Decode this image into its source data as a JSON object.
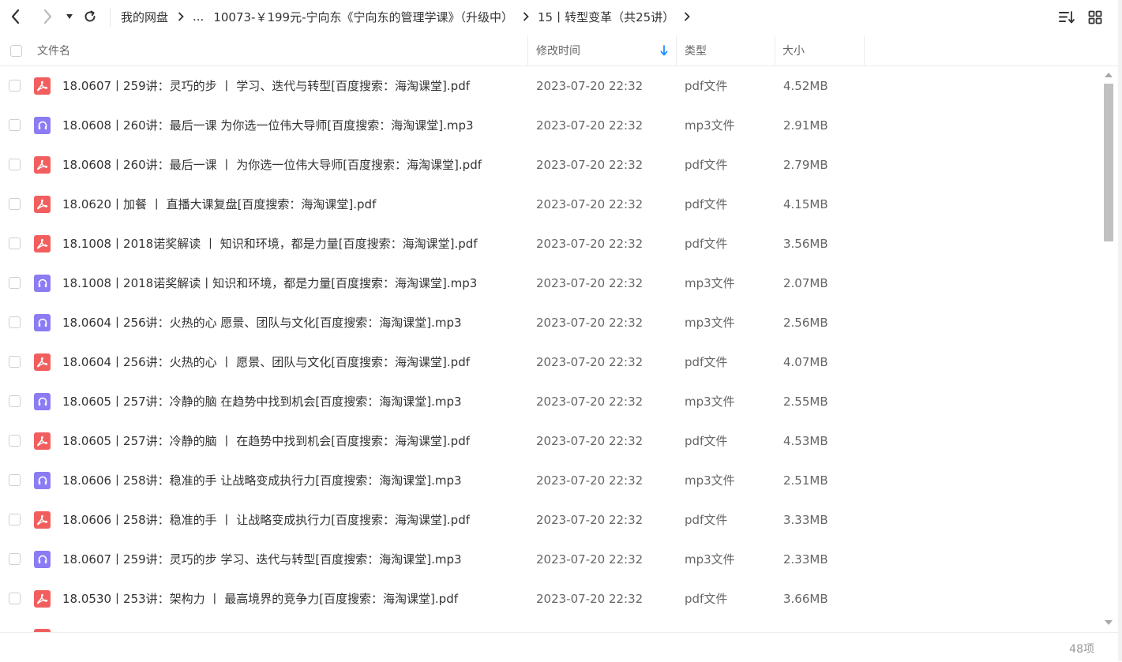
{
  "toolbar": {
    "back_icon": "chevron-left-icon",
    "forward_icon": "chevron-right-icon",
    "history_icon": "caret-down-icon",
    "refresh_icon": "refresh-icon",
    "sort_icon": "sort-list-icon",
    "grid_icon": "grid-view-icon"
  },
  "breadcrumb": {
    "items": [
      "我的网盘",
      "...",
      "10073-￥199元-宁向东《宁向东的管理学课》（升级中）",
      "15丨转型变革（共25讲）"
    ]
  },
  "table": {
    "columns": {
      "name": "文件名",
      "time": "修改时间",
      "type": "类型",
      "size": "大小"
    },
    "sort_icon": "arrow-down-icon",
    "rows": [
      {
        "name": "18.0607丨259讲：灵巧的步 丨 学习、迭代与转型[百度搜索：海淘课堂].pdf",
        "time": "2023-07-20 22:32",
        "type": "pdf文件",
        "size": "4.52MB",
        "kind": "pdf"
      },
      {
        "name": "18.0608丨260讲：最后一课 为你选一位伟大导师[百度搜索：海淘课堂].mp3",
        "time": "2023-07-20 22:32",
        "type": "mp3文件",
        "size": "2.91MB",
        "kind": "mp3"
      },
      {
        "name": "18.0608丨260讲：最后一课 丨 为你选一位伟大导师[百度搜索：海淘课堂].pdf",
        "time": "2023-07-20 22:32",
        "type": "pdf文件",
        "size": "2.79MB",
        "kind": "pdf"
      },
      {
        "name": "18.0620丨加餐 丨 直播大课复盘[百度搜索：海淘课堂].pdf",
        "time": "2023-07-20 22:32",
        "type": "pdf文件",
        "size": "4.15MB",
        "kind": "pdf"
      },
      {
        "name": "18.1008丨2018诺奖解读 丨 知识和环境，都是力量[百度搜索：海淘课堂].pdf",
        "time": "2023-07-20 22:32",
        "type": "pdf文件",
        "size": "3.56MB",
        "kind": "pdf"
      },
      {
        "name": "18.1008丨2018诺奖解读丨知识和环境，都是力量[百度搜索：海淘课堂].mp3",
        "time": "2023-07-20 22:32",
        "type": "mp3文件",
        "size": "2.07MB",
        "kind": "mp3"
      },
      {
        "name": "18.0604丨256讲：火热的心 愿景、团队与文化[百度搜索：海淘课堂].mp3",
        "time": "2023-07-20 22:32",
        "type": "mp3文件",
        "size": "2.56MB",
        "kind": "mp3"
      },
      {
        "name": "18.0604丨256讲：火热的心 丨 愿景、团队与文化[百度搜索：海淘课堂].pdf",
        "time": "2023-07-20 22:32",
        "type": "pdf文件",
        "size": "4.07MB",
        "kind": "pdf"
      },
      {
        "name": "18.0605丨257讲：冷静的脑 在趋势中找到机会[百度搜索：海淘课堂].mp3",
        "time": "2023-07-20 22:32",
        "type": "mp3文件",
        "size": "2.55MB",
        "kind": "mp3"
      },
      {
        "name": "18.0605丨257讲：冷静的脑 丨 在趋势中找到机会[百度搜索：海淘课堂].pdf",
        "time": "2023-07-20 22:32",
        "type": "pdf文件",
        "size": "4.53MB",
        "kind": "pdf"
      },
      {
        "name": "18.0606丨258讲：稳准的手 让战略变成执行力[百度搜索：海淘课堂].mp3",
        "time": "2023-07-20 22:32",
        "type": "mp3文件",
        "size": "2.51MB",
        "kind": "mp3"
      },
      {
        "name": "18.0606丨258讲：稳准的手 丨 让战略变成执行力[百度搜索：海淘课堂].pdf",
        "time": "2023-07-20 22:32",
        "type": "pdf文件",
        "size": "3.33MB",
        "kind": "pdf"
      },
      {
        "name": "18.0607丨259讲：灵巧的步 学习、迭代与转型[百度搜索：海淘课堂].mp3",
        "time": "2023-07-20 22:32",
        "type": "mp3文件",
        "size": "2.33MB",
        "kind": "mp3"
      },
      {
        "name": "18.0530丨253讲：架构力 丨 最高境界的竞争力[百度搜索：海淘课堂].pdf",
        "time": "2023-07-20 22:32",
        "type": "pdf文件",
        "size": "3.66MB",
        "kind": "pdf"
      }
    ]
  },
  "footer": {
    "count": "48项"
  },
  "colors": {
    "pdf": "#f25e5e",
    "mp3": "#8b7cf3",
    "sort_accent": "#1e90ff"
  }
}
